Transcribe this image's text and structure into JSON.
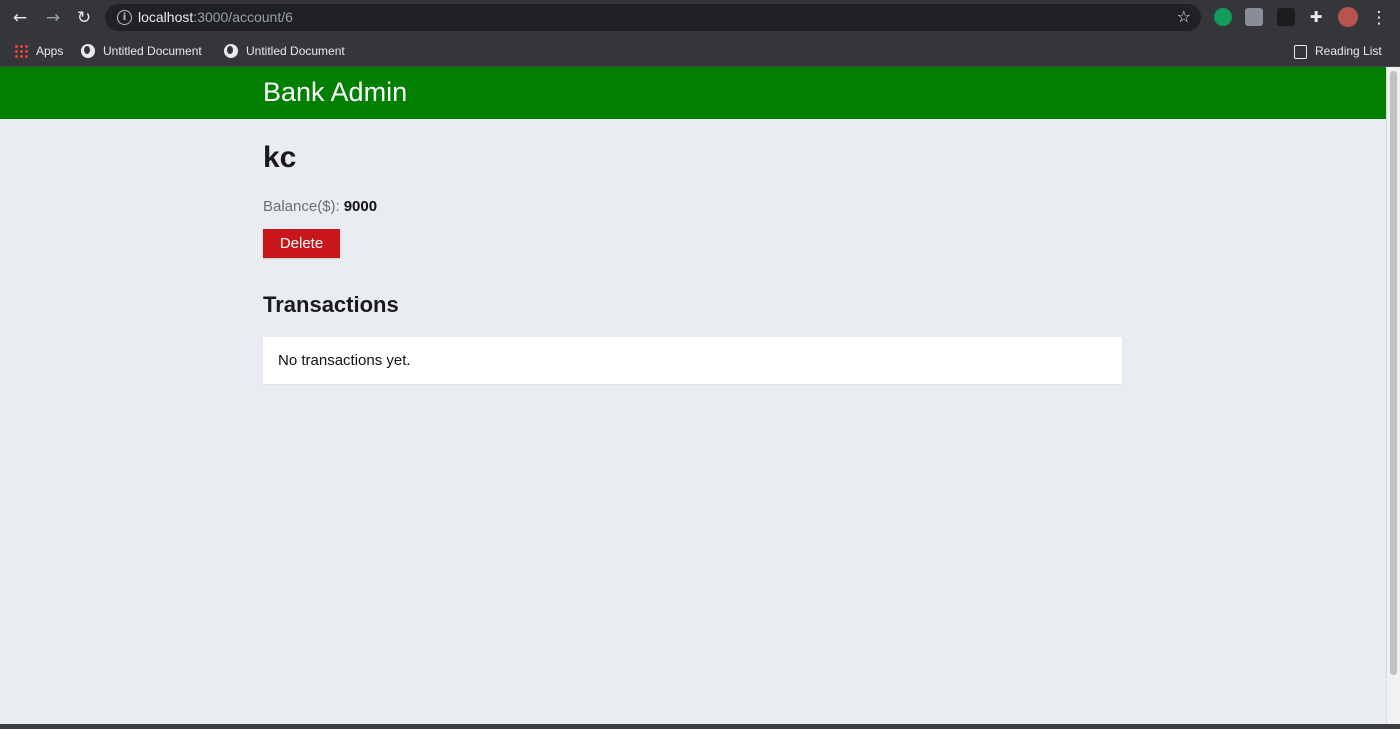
{
  "browser": {
    "url_host": "localhost",
    "url_path": ":3000/account/6",
    "bookmarks": [
      "Apps",
      "Untitled Document",
      "Untitled Document"
    ],
    "reading_list": "Reading List"
  },
  "app": {
    "brand": "Bank Admin"
  },
  "account": {
    "name": "kc",
    "balance_label": "Balance($):",
    "balance_value": "9000",
    "delete_label": "Delete"
  },
  "transactions": {
    "title": "Transactions",
    "empty_message": "No transactions yet."
  },
  "colors": {
    "header": "#017f01",
    "delete": "#c8161b",
    "background": "#e9ecf1"
  }
}
